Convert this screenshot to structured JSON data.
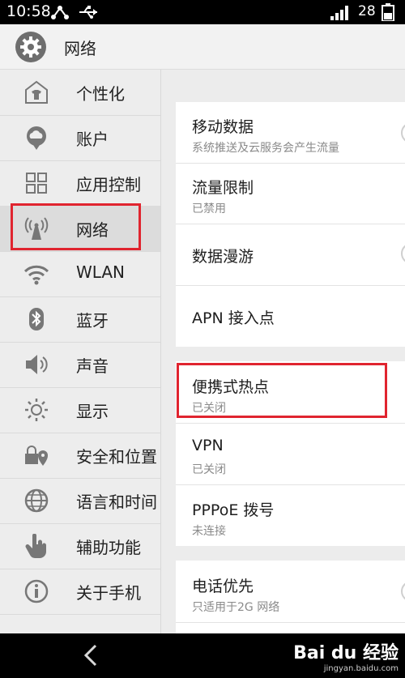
{
  "status_bar": {
    "time": "10:58",
    "battery": "28"
  },
  "header": {
    "title": "网络"
  },
  "sidebar": {
    "items": [
      {
        "label": "个性化",
        "icon": "shirt-icon"
      },
      {
        "label": "账户",
        "icon": "cloud-chat-icon"
      },
      {
        "label": "应用控制",
        "icon": "grid-icon"
      },
      {
        "label": "网络",
        "icon": "antenna-icon",
        "active": true
      },
      {
        "label": "WLAN",
        "icon": "wifi-icon"
      },
      {
        "label": "蓝牙",
        "icon": "bluetooth-icon"
      },
      {
        "label": "声音",
        "icon": "speaker-icon"
      },
      {
        "label": "显示",
        "icon": "brightness-icon"
      },
      {
        "label": "安全和位置",
        "icon": "lock-location-icon"
      },
      {
        "label": "语言和时间",
        "icon": "globe-icon"
      },
      {
        "label": "辅助功能",
        "icon": "hand-icon"
      },
      {
        "label": "关于手机",
        "icon": "info-icon"
      }
    ]
  },
  "content": {
    "mobile_data": {
      "title": "移动数据",
      "subtitle": "系统推送及云服务会产生流量"
    },
    "traffic_limit": {
      "title": "流量限制",
      "subtitle": "已禁用"
    },
    "data_roaming": {
      "title": "数据漫游"
    },
    "apn": {
      "title": "APN 接入点"
    },
    "hotspot": {
      "title": "便携式热点",
      "subtitle": "已关闭"
    },
    "vpn": {
      "title": "VPN",
      "subtitle": "已关闭"
    },
    "pppoe": {
      "title": "PPPoE 拨号",
      "subtitle": "未连接"
    },
    "call_priority": {
      "title": "电话优先",
      "subtitle": "只适用于2G 网络"
    }
  },
  "watermark": {
    "brand": "Bai du 经验",
    "url": "jingyan.baidu.com"
  },
  "colors": {
    "highlight": "#e0242f",
    "status_bar": "#000000"
  }
}
